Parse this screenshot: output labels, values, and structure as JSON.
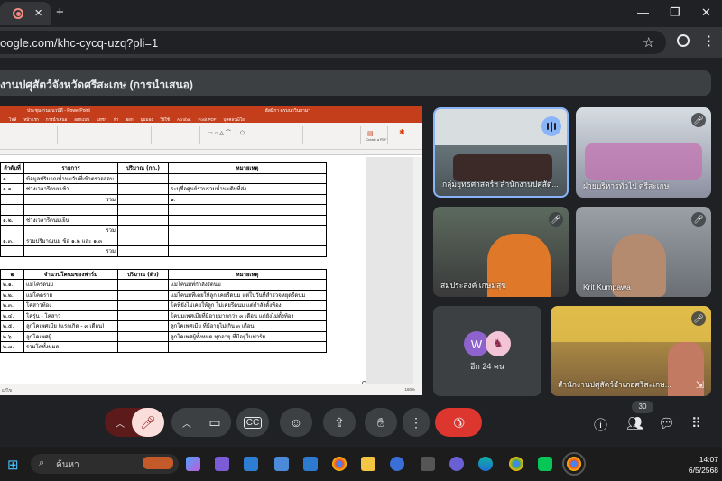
{
  "browser": {
    "url": "oogle.com/khc-cycq-uzq?pli=1",
    "tab_close": "✕",
    "new_tab": "+",
    "window_controls": [
      "—",
      "❐",
      "✕"
    ]
  },
  "meeting": {
    "presentation_title": "งานปศุสัตว์จังหวัดศรีสะเกษ (การนำเสนอ)"
  },
  "powerpoint": {
    "title_left": "ประชุมงานแนวบัดี - PowerPoint",
    "title_user": "ฮัสมิกา ครบนาวินยามา",
    "tabs": [
      "ไฟล์",
      "หน้าแรก",
      "การนำเสนอ",
      "ออกแบบ",
      "แทรก",
      "ทำ",
      "ออก",
      "มุมมอง",
      "วิธีใช้",
      "Acrobat",
      "Foxit PDF",
      "บุคคลวุฒิโอ"
    ],
    "create_pdf": "Create a PDF",
    "status_left": "แก้ไข",
    "zoom": "160%"
  },
  "document": {
    "section1": {
      "headers": [
        "ลำดับที่",
        "รายการ",
        "ปริมาณ (กก.)",
        "หมายเหตุ"
      ],
      "rows": [
        [
          "๑",
          "ข้อมูลปริมาณน้ำนมวันที่เข้าตรวจสอบ",
          "",
          ""
        ],
        [
          "๑.๑.",
          "ช่วงเวลารีดนมเช้า",
          "",
          "ระบุชื่อศูนย์รวบรวมน้ำนมดิบที่ส่ง"
        ],
        [
          "",
          "รวม",
          "",
          "๑."
        ],
        [
          "",
          "",
          "",
          ""
        ],
        [
          "๑.๒.",
          "ช่วงเวลารีดนมเย็น",
          "",
          ""
        ],
        [
          "",
          "รวม",
          "",
          ""
        ],
        [
          "๑.๓.",
          "รวมปริมาณนม ข้อ ๑.๒ และ ๑.๓",
          "",
          ""
        ],
        [
          "",
          "รวม",
          "",
          ""
        ]
      ]
    },
    "section2": {
      "headers": [
        "๒",
        "จำนวนโคนมของฟาร์ม",
        "ปริมาณ (ตัว)",
        "หมายเหตุ"
      ],
      "rows": [
        [
          "๒.๑.",
          "แม่โครีดนม",
          "",
          "แม่โคนมที่กำลังรีดนม"
        ],
        [
          "๒.๒.",
          "แม่โคดราย",
          "",
          "แม่โคนมที่เคยให้ลูก เคยรีดนม แต่ในวันที่สำรวจหยุดรีดนม"
        ],
        [
          "๒.๓.",
          "โคสาวท้อง",
          "",
          "โคที่ยังไม่เคยให้ลูก ไม่เคยรีดนม แต่กำลังตั้งท้อง"
        ],
        [
          "๒.๔.",
          "โครุ่น - โคสาว",
          "",
          "โคนมเพศเมียที่มีอายุมากกว่า ๓ เดือน แต่ยังไม่ตั้งท้อง"
        ],
        [
          "๒.๕.",
          "ลูกโคเพศเมีย (แรกเกิด - ๓ เดือน)",
          "",
          "ลูกโคเพศเมีย ที่มีอายุไม่เกิน ๓ เดือน"
        ],
        [
          "๒.๖.",
          "ลูกโคเพศผู้",
          "",
          "ลูกโคเพศผู้ทั้งหมด ทุกอายุ ที่มีอยู่ในฟาร์ม"
        ],
        [
          "๒.๗.",
          "รวมโคทั้งหมด",
          "",
          ""
        ]
      ]
    }
  },
  "participants": [
    {
      "name": "กลุ่มยุทธศาสตร์ฯ สำนักงานปศุสัต...",
      "speaking": true
    },
    {
      "name": "ฝ่ายบริหารทั่วไป ศรีสะเกษ",
      "muted": true
    },
    {
      "name": "สมประสงค์ เกษมสุข",
      "muted": true
    },
    {
      "name": "Krit Kumpawa",
      "muted": true
    },
    {
      "name": "สำนักงานปศุสัตว์อำเภอศรีสะเกษ...",
      "muted": true
    }
  ],
  "others": {
    "label": "อีก 24 คน",
    "avatar_letter": "W"
  },
  "controls": {
    "participant_count": "30"
  },
  "taskbar": {
    "search_placeholder": "ค้นหา",
    "time": "14:07",
    "date": "6/5/2568"
  }
}
